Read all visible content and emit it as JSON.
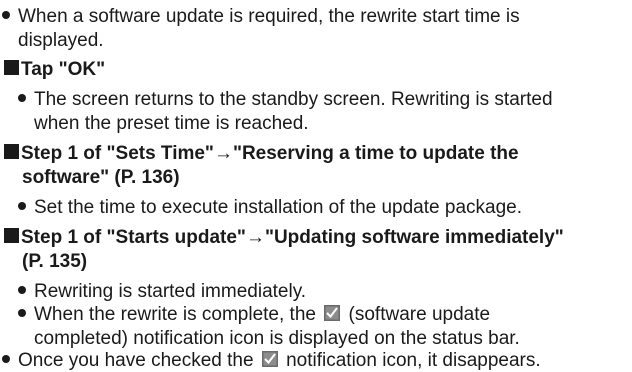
{
  "paragraphs": {
    "p1_line1": "When a software update is required, the rewrite start time is",
    "p1_line2": "displayed.",
    "h1": "Tap \"OK\"",
    "p2_line1": "The screen returns to the standby screen. Rewriting is started",
    "p2_line2": "when the preset time is reached.",
    "h2_line1": "Step 1 of \"Sets Time\"→\"Reserving a time to update the",
    "h2_line2": "software\" (P. 136)",
    "p3_line1": "Set the time to execute installation of the update package.",
    "h3_line1": "Step 1 of \"Starts update\"→\"Updating software immediately\"",
    "h3_line2": "(P. 135)",
    "p4_line1": "Rewriting is started immediately.",
    "p5_line1a": "When the rewrite is complete, the",
    "p5_line1b": "(software update",
    "p5_line2": "completed) notification icon is displayed on the status bar.",
    "p6_line1a": "Once you have checked the",
    "p6_line1b": "notification icon, it disappears."
  },
  "icons": {
    "update_completed_icon": "software-update-completed-icon"
  }
}
